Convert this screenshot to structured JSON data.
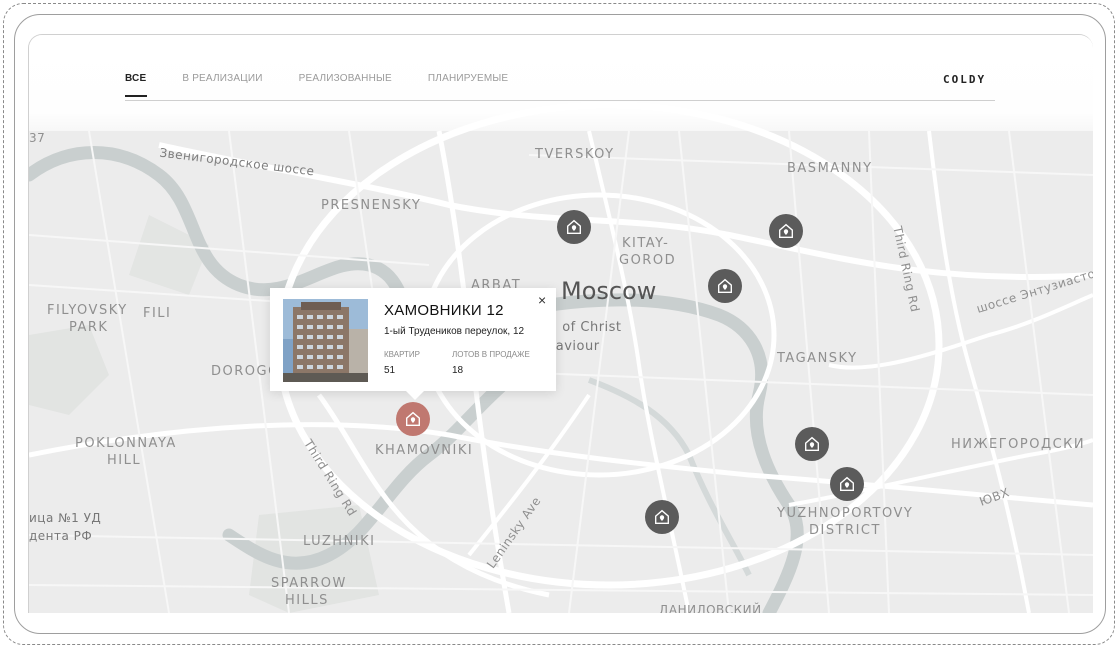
{
  "header": {
    "tabs": [
      {
        "label": "ВСЕ",
        "active": true
      },
      {
        "label": "В РЕАЛИЗАЦИИ",
        "active": false
      },
      {
        "label": "РЕАЛИЗОВАННЫЕ",
        "active": false
      },
      {
        "label": "ПЛАНИРУЕМЫЕ",
        "active": false
      }
    ],
    "logo": "COLDY"
  },
  "map": {
    "city": "Moscow",
    "labels": {
      "tverskoy": "TVERSKOY",
      "basmanny": "BASMANNY",
      "presnensky": "PRESNENSKY",
      "kitay": "KITAY-",
      "gorod": "GOROD",
      "arbat": "ARBAT",
      "filyovsky": "FILYOVSKY",
      "park": "PARK",
      "fili": "FILI",
      "dorogo": "DOROGO",
      "taagansky": "TAGANSKY",
      "poklonnaya": "POKLONNAYA",
      "hill": "HILL",
      "khamovniki": "KHAMOVNIKI",
      "nizhegorodsky": "НИЖЕГОРОДСКИ",
      "yuzhno": "YUZHNOPORTOVY",
      "district": "DISTRICT",
      "luzhniki": "LUZHNIKI",
      "sparrow": "SPARROW",
      "hills": "HILLS",
      "zvenigorod": "Звенигородское шоссе",
      "third_ring_1": "Third Ring Rd",
      "third_ring_2": "Third Ring Rd",
      "entuziastov": "шоссе Энтузиастов",
      "leninsky": "Leninsky Ave",
      "uvh": "ЮВХ",
      "christ1": "al of Christ",
      "christ2": "Saviour",
      "left1": "ица №1 УД",
      "left2": "дента РФ",
      "bottom": "ДАНИЛОВСКИЙ",
      "num37": "37"
    },
    "pin_icon": "building-location-icon",
    "colors": {
      "pin": "#5b5b5b",
      "pin_active": "#c07870",
      "water": "#c9cfcf",
      "road": "#ffffff",
      "land": "#ececec"
    }
  },
  "popup": {
    "title": "ХАМОВНИКИ 12",
    "address": "1-ый Трудеников переулок, 12",
    "label_apartments": "КВАРТИР",
    "label_lots": "ЛОТОВ В ПРОДАЖЕ",
    "apartments": "51",
    "lots": "18",
    "close": "×"
  }
}
